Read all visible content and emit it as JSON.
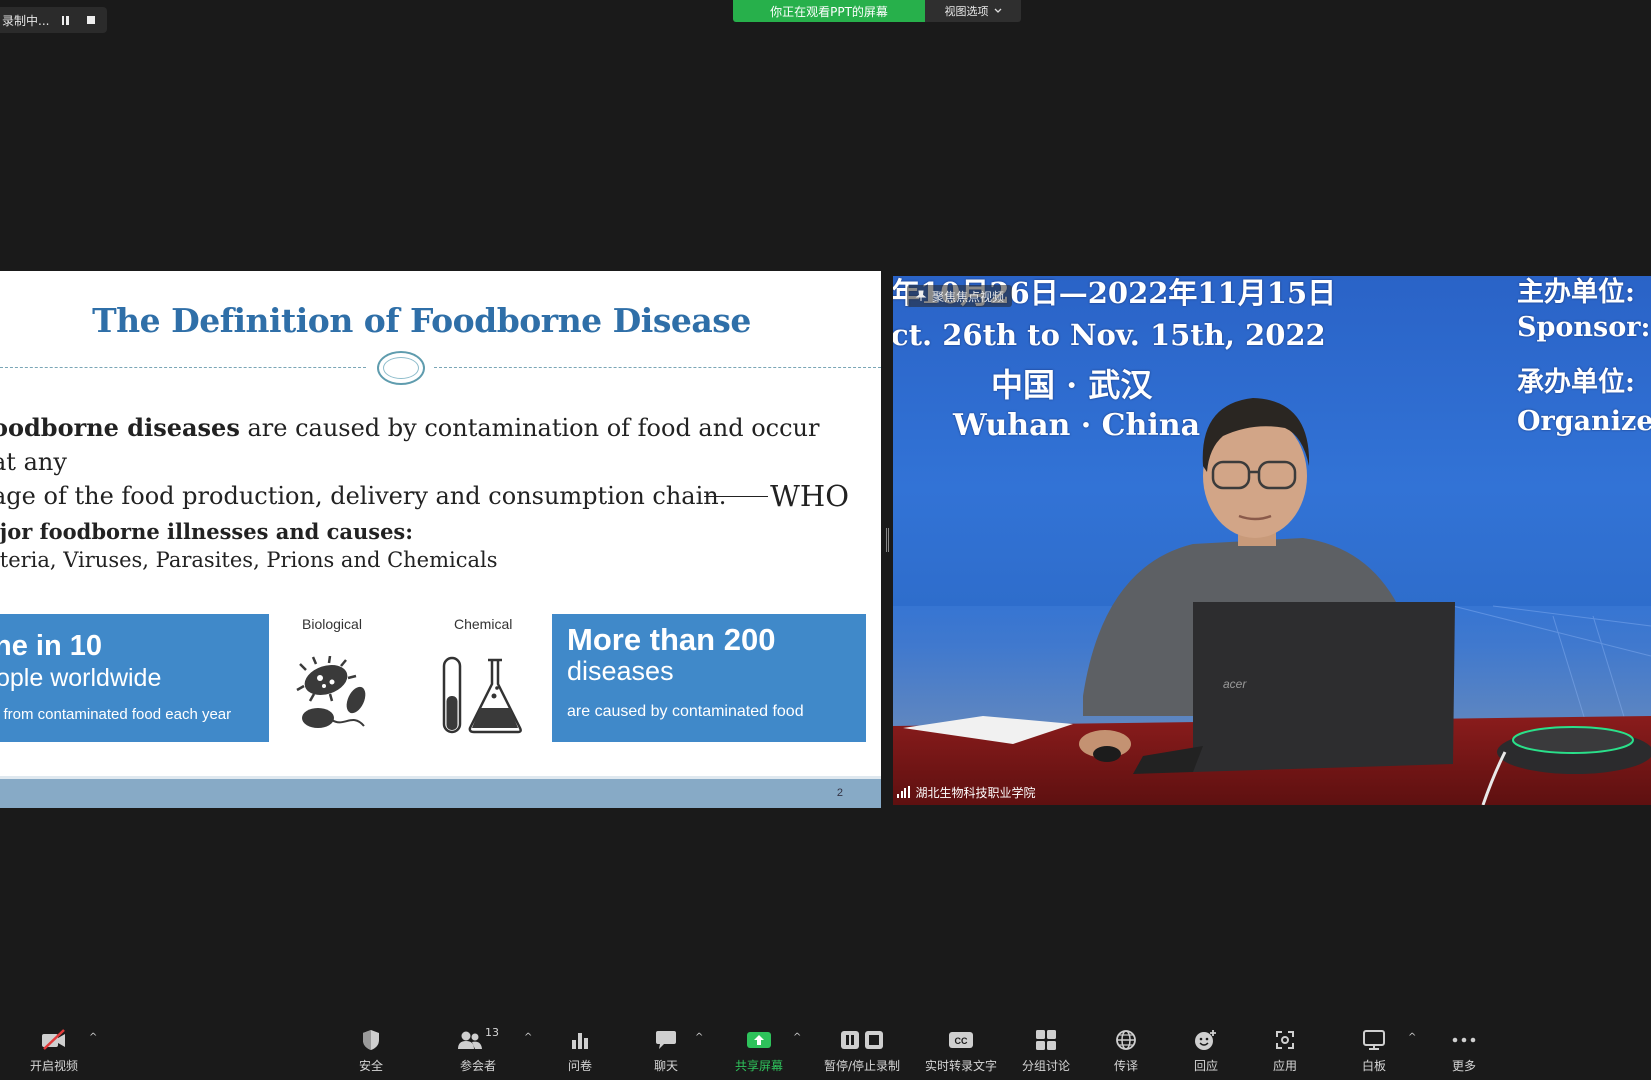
{
  "recording": {
    "label": "录制中..."
  },
  "banner": {
    "text": "你正在观看PPT的屏幕",
    "view_options": "视图选项"
  },
  "slide": {
    "title": "The Definition of Foodborne Disease",
    "definition_bold": "oodborne diseases",
    "definition_rest": " are caused by contamination of food and occur at any",
    "definition_line2": "age of the food production, delivery and consumption chain.",
    "attribution": "WHO",
    "major_heading": "ajor foodborne illnesses and causes:",
    "causes": "cteria, Viruses, Parasites, Prions and Chemicals",
    "box1": {
      "line1": "ne in 10",
      "line2": "ople worldwide",
      "line3": "l from contaminated food each year"
    },
    "icon_biological": "Biological",
    "icon_chemical": "Chemical",
    "box2": {
      "line1": "More than 200",
      "line2": "diseases",
      "line3": "are caused by contaminated food"
    },
    "page_number": "2"
  },
  "video": {
    "spotlight": "聚焦焦点视频",
    "backdrop": {
      "date_cn": "年10月26日—2022年11月15日",
      "date_en": "ct. 26th to Nov. 15th, 2022",
      "city_cn": "中国 · 武汉",
      "city_en": "Wuhan · China",
      "sponsor_cn": "主办单位:",
      "sponsor_en": "Sponsor:",
      "organizer_cn": "承办单位:",
      "organizer_en": "Organize"
    },
    "laptop_brand": "acer",
    "participant_name": "湖北生物科技职业学院"
  },
  "toolbar": {
    "items": [
      {
        "label": "开启视频"
      },
      {
        "label": "安全"
      },
      {
        "label": "参会者",
        "count": "13"
      },
      {
        "label": "问卷"
      },
      {
        "label": "聊天"
      },
      {
        "label": "共享屏幕"
      },
      {
        "label": "暂停/停止录制"
      },
      {
        "label": "实时转录文字"
      },
      {
        "label": "分组讨论"
      },
      {
        "label": "传译"
      },
      {
        "label": "回应"
      },
      {
        "label": "应用"
      },
      {
        "label": "白板"
      },
      {
        "label": "更多"
      }
    ]
  },
  "colors": {
    "share_green": "#27b04b",
    "slide_blue": "#4089c9",
    "title_blue": "#2f6fa8"
  }
}
